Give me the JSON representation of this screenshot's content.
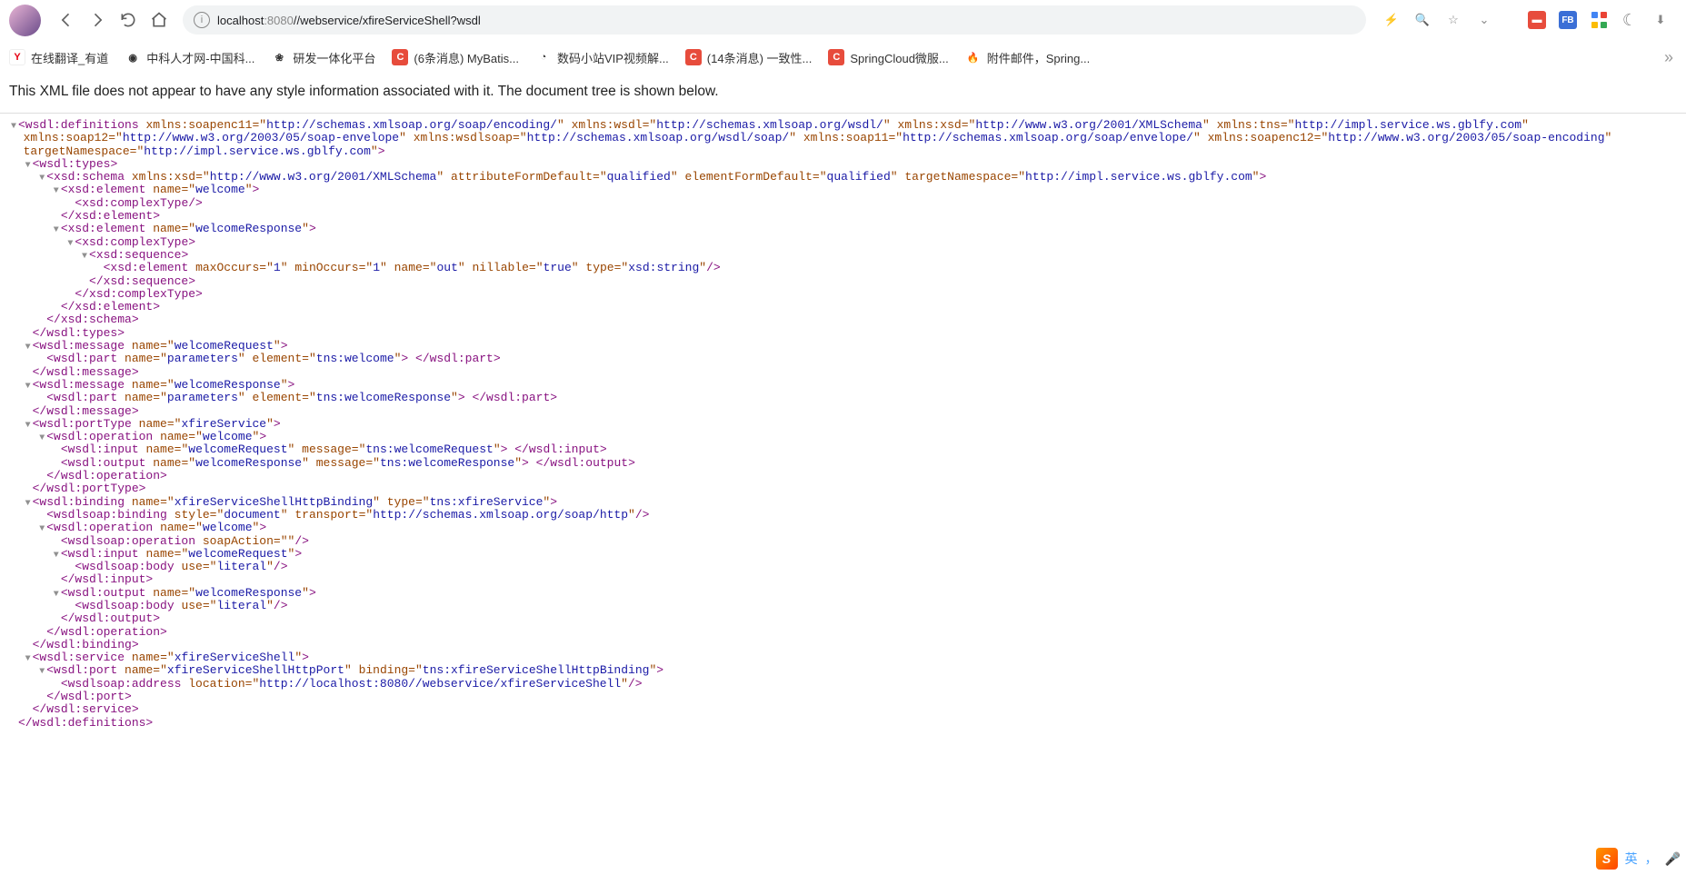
{
  "toolbar": {
    "url_host": "localhost",
    "url_port": ":8080",
    "url_path": "//webservice/xfireServiceShell?wsdl"
  },
  "bookmarks": [
    {
      "icon": "Y",
      "cls": "bmi-y",
      "label": "在线翻译_有道"
    },
    {
      "icon": "◉",
      "cls": "bmi-g",
      "label": "中科人才网-中国科..."
    },
    {
      "icon": "❀",
      "cls": "bmi-o",
      "label": "研发一体化平台"
    },
    {
      "icon": "C",
      "cls": "bmi-c",
      "label": "(6条消息) MyBatis..."
    },
    {
      "icon": "◔",
      "cls": "bmi-b",
      "label": "数码小站VIP视频解..."
    },
    {
      "icon": "C",
      "cls": "bmi-c",
      "label": "(14条消息) 一致性..."
    },
    {
      "icon": "C",
      "cls": "bmi-c",
      "label": "SpringCloud微服..."
    },
    {
      "icon": "🔥",
      "cls": "bmi-f",
      "label": "附件邮件，Spring..."
    }
  ],
  "info_line": "This XML file does not appear to have any style information associated with it. The document tree is shown below.",
  "ime": {
    "lang": "英"
  },
  "xml": {
    "root_open": "wsdl:definitions",
    "root_attrs": [
      {
        "n": "xmlns:soapenc11",
        "v": "http://schemas.xmlsoap.org/soap/encoding/"
      },
      {
        "n": "xmlns:wsdl",
        "v": "http://schemas.xmlsoap.org/wsdl/"
      },
      {
        "n": "xmlns:xsd",
        "v": "http://www.w3.org/2001/XMLSchema"
      },
      {
        "n": "xmlns:tns",
        "v": "http://impl.service.ws.gblfy.com"
      },
      {
        "n": "xmlns:soap12",
        "v": "http://www.w3.org/2003/05/soap-envelope"
      },
      {
        "n": "xmlns:wsdlsoap",
        "v": "http://schemas.xmlsoap.org/wsdl/soap/"
      },
      {
        "n": "xmlns:soap11",
        "v": "http://schemas.xmlsoap.org/soap/envelope/"
      },
      {
        "n": "xmlns:soapenc12",
        "v": "http://www.w3.org/2003/05/soap-encoding"
      },
      {
        "n": "targetNamespace",
        "v": "http://impl.service.ws.gblfy.com"
      }
    ],
    "types": {
      "tag": "wsdl:types",
      "schema": {
        "tag": "xsd:schema",
        "attrs": [
          {
            "n": "xmlns:xsd",
            "v": "http://www.w3.org/2001/XMLSchema"
          },
          {
            "n": "attributeFormDefault",
            "v": "qualified"
          },
          {
            "n": "elementFormDefault",
            "v": "qualified"
          },
          {
            "n": "targetNamespace",
            "v": "http://impl.service.ws.gblfy.com"
          }
        ],
        "el1": {
          "tag": "xsd:element",
          "name": "welcome",
          "ct": "xsd:complexType"
        },
        "el2": {
          "tag": "xsd:element",
          "name": "welcomeResponse",
          "ct": "xsd:complexType",
          "seq": "xsd:sequence",
          "inner": {
            "tag": "xsd:element",
            "attrs": [
              {
                "n": "maxOccurs",
                "v": "1"
              },
              {
                "n": "minOccurs",
                "v": "1"
              },
              {
                "n": "name",
                "v": "out"
              },
              {
                "n": "nillable",
                "v": "true"
              },
              {
                "n": "type",
                "v": "xsd:string"
              }
            ]
          }
        }
      }
    },
    "msg1": {
      "tag": "wsdl:message",
      "name": "welcomeRequest",
      "part": {
        "tag": "wsdl:part",
        "attrs": [
          {
            "n": "name",
            "v": "parameters"
          },
          {
            "n": "element",
            "v": "tns:welcome"
          }
        ]
      }
    },
    "msg2": {
      "tag": "wsdl:message",
      "name": "welcomeResponse",
      "part": {
        "tag": "wsdl:part",
        "attrs": [
          {
            "n": "name",
            "v": "parameters"
          },
          {
            "n": "element",
            "v": "tns:welcomeResponse"
          }
        ]
      }
    },
    "portType": {
      "tag": "wsdl:portType",
      "name": "xfireService",
      "op": {
        "tag": "wsdl:operation",
        "name": "welcome",
        "in": {
          "tag": "wsdl:input",
          "attrs": [
            {
              "n": "name",
              "v": "welcomeRequest"
            },
            {
              "n": "message",
              "v": "tns:welcomeRequest"
            }
          ]
        },
        "out": {
          "tag": "wsdl:output",
          "attrs": [
            {
              "n": "name",
              "v": "welcomeResponse"
            },
            {
              "n": "message",
              "v": "tns:welcomeResponse"
            }
          ]
        }
      }
    },
    "binding": {
      "tag": "wsdl:binding",
      "attrs": [
        {
          "n": "name",
          "v": "xfireServiceShellHttpBinding"
        },
        {
          "n": "type",
          "v": "tns:xfireService"
        }
      ],
      "sb": {
        "tag": "wsdlsoap:binding",
        "attrs": [
          {
            "n": "style",
            "v": "document"
          },
          {
            "n": "transport",
            "v": "http://schemas.xmlsoap.org/soap/http"
          }
        ]
      },
      "op": {
        "tag": "wsdl:operation",
        "name": "welcome",
        "so": {
          "tag": "wsdlsoap:operation",
          "attrs": [
            {
              "n": "soapAction",
              "v": ""
            }
          ]
        },
        "in": {
          "tag": "wsdl:input",
          "name": "welcomeRequest",
          "body": {
            "tag": "wsdlsoap:body",
            "attrs": [
              {
                "n": "use",
                "v": "literal"
              }
            ]
          }
        },
        "out": {
          "tag": "wsdl:output",
          "name": "welcomeResponse",
          "body": {
            "tag": "wsdlsoap:body",
            "attrs": [
              {
                "n": "use",
                "v": "literal"
              }
            ]
          }
        }
      }
    },
    "service": {
      "tag": "wsdl:service",
      "name": "xfireServiceShell",
      "port": {
        "tag": "wsdl:port",
        "attrs": [
          {
            "n": "name",
            "v": "xfireServiceShellHttpPort"
          },
          {
            "n": "binding",
            "v": "tns:xfireServiceShellHttpBinding"
          }
        ],
        "addr": {
          "tag": "wsdlsoap:address",
          "attrs": [
            {
              "n": "location",
              "v": "http://localhost:8080//webservice/xfireServiceShell"
            }
          ]
        }
      }
    }
  }
}
